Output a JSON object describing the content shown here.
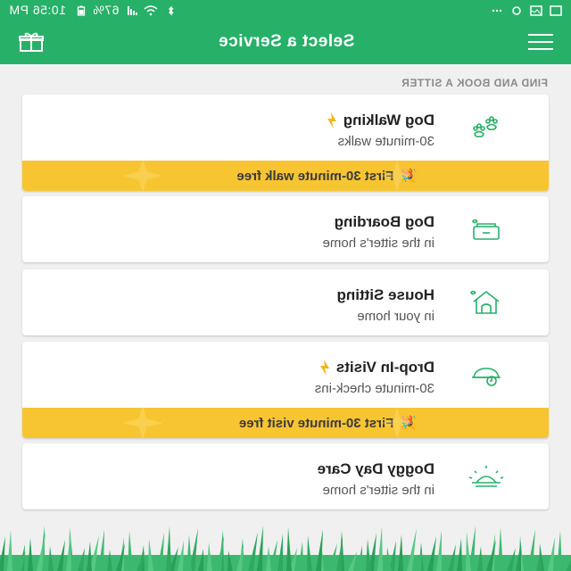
{
  "status_bar": {
    "time": "10:56 PM",
    "battery": "67%"
  },
  "app_bar": {
    "title": "Select a Service"
  },
  "section_header": "FIND AND BOOK A SITTER",
  "services": [
    {
      "title": "Dog Walking",
      "subtitle": "30-minute walks",
      "icon": "dog-paw-icon",
      "promo": "First 30-minute walk free",
      "promo_emoji": "🎉"
    },
    {
      "title": "Dog Boarding",
      "subtitle": "in the sitter's home",
      "icon": "dog-bed-icon"
    },
    {
      "title": "House Sitting",
      "subtitle": "in your home",
      "icon": "house-dog-icon"
    },
    {
      "title": "Drop-In Visits",
      "subtitle": "30-minute check-ins",
      "icon": "food-bowl-clock-icon",
      "promo": "First 30-minute visit free",
      "promo_emoji": "🎉"
    },
    {
      "title": "Doggy Day Care",
      "subtitle": "in the sitter's home",
      "icon": "sun-icon"
    }
  ],
  "colors": {
    "brand_green": "#27b068",
    "promo_yellow": "#f7c531",
    "bolt_yellow": "#f2b51d"
  }
}
